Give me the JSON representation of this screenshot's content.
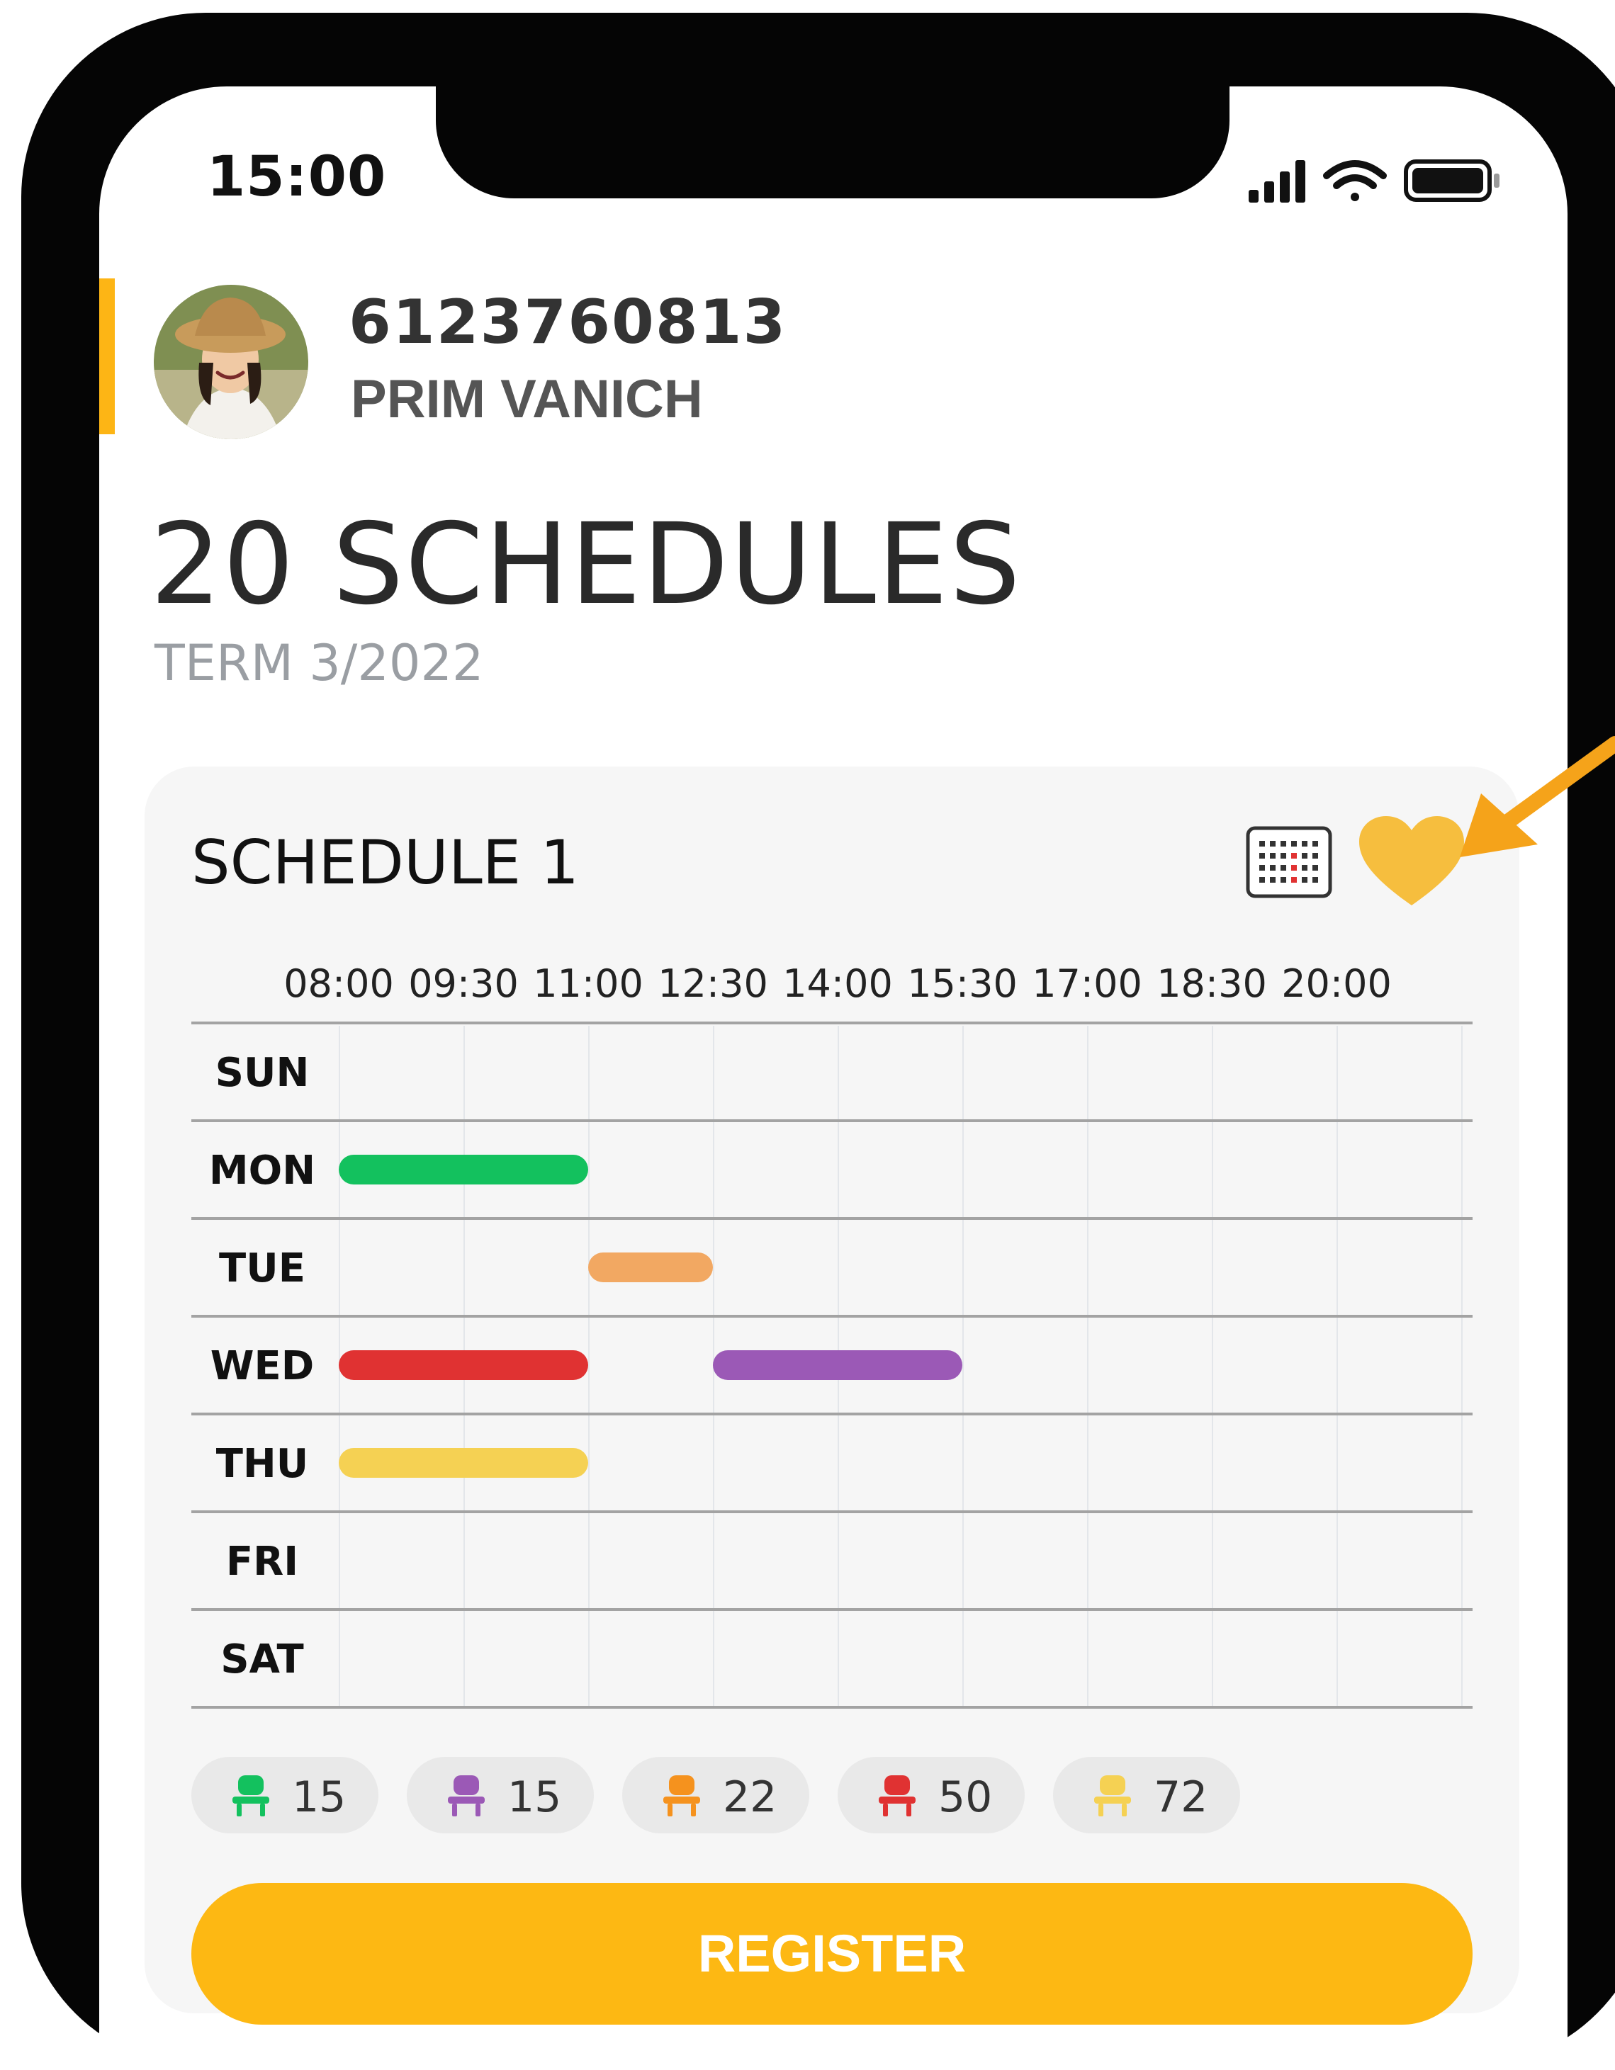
{
  "status_bar": {
    "time": "15:00",
    "icons": [
      "signal-icon",
      "wifi-icon",
      "battery-icon"
    ]
  },
  "profile": {
    "student_id": "6123760813",
    "name": "PRIM VANICH"
  },
  "summary": {
    "headline": "20 SCHEDULES",
    "term": "TERM 3/2022"
  },
  "schedule": {
    "title": "SCHEDULE 1",
    "time_slots": [
      "08:00",
      "09:30",
      "11:00",
      "12:30",
      "14:00",
      "15:30",
      "17:00",
      "18:30",
      "20:00"
    ],
    "days": [
      "SUN",
      "MON",
      "TUE",
      "WED",
      "THU",
      "FRI",
      "SAT"
    ],
    "classes": [
      {
        "day": "MON",
        "start": "08:00",
        "end": "11:00",
        "color": "#13C15E"
      },
      {
        "day": "TUE",
        "start": "11:00",
        "end": "12:30",
        "color": "#F2A862"
      },
      {
        "day": "WED",
        "start": "08:00",
        "end": "11:00",
        "color": "#E03232"
      },
      {
        "day": "WED",
        "start": "12:30",
        "end": "15:30",
        "color": "#9B59B6"
      },
      {
        "day": "THU",
        "start": "08:00",
        "end": "11:00",
        "color": "#F5D153"
      }
    ],
    "seat_legend": [
      {
        "color": "#13C15E",
        "count": "15"
      },
      {
        "color": "#9B59B6",
        "count": "15"
      },
      {
        "color": "#F5921E",
        "count": "22"
      },
      {
        "color": "#E03232",
        "count": "50"
      },
      {
        "color": "#F5D153",
        "count": "72"
      }
    ],
    "register_label": "REGISTER"
  },
  "colors": {
    "accent": "#FDB813",
    "heart": "#F6BE3E",
    "arrow": "#F5A31A"
  }
}
